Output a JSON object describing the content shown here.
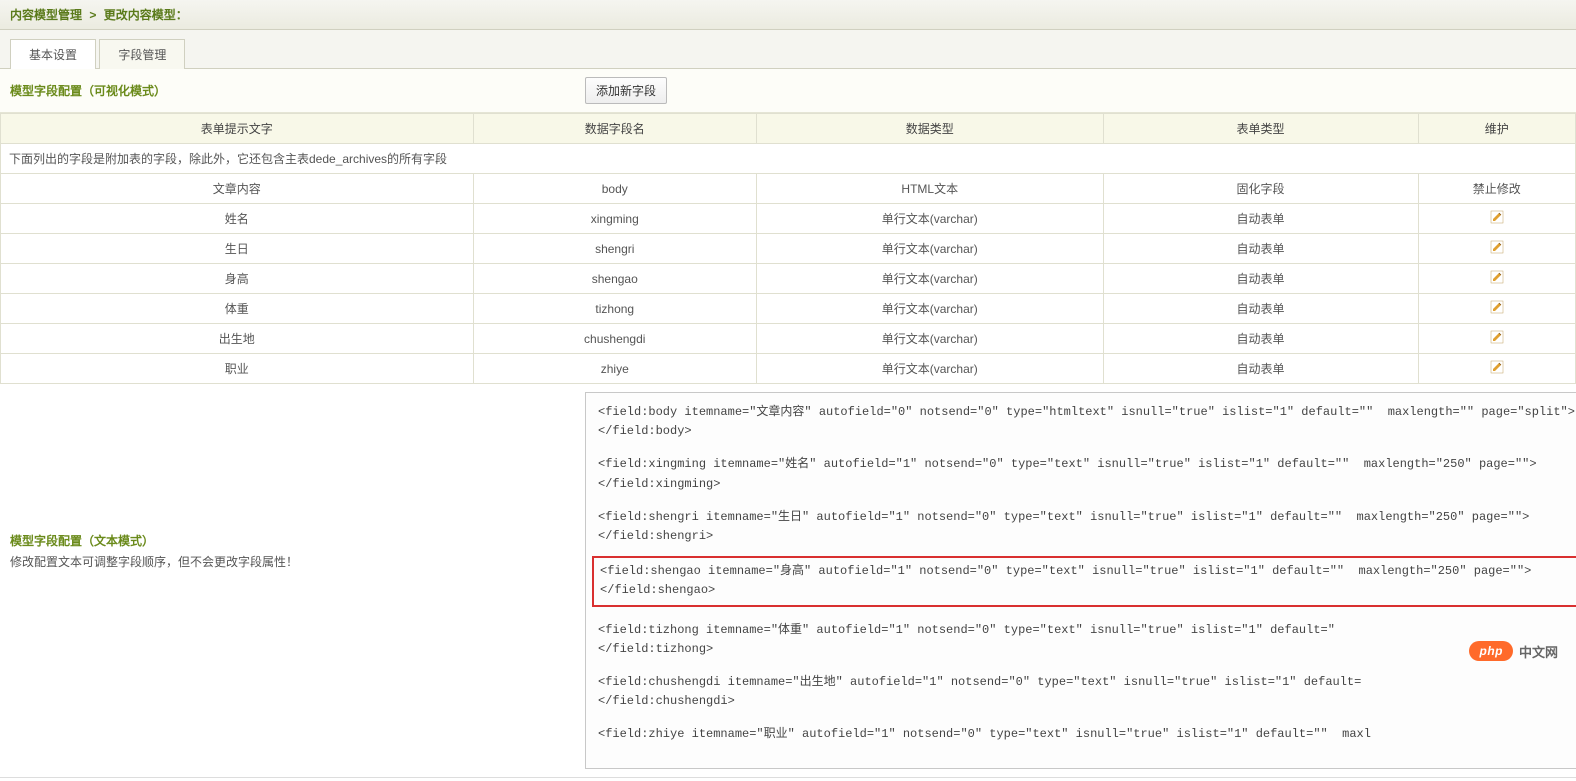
{
  "breadcrumb": {
    "root": "内容模型管理",
    "separator": ">",
    "current": "更改内容模型："
  },
  "tabs": {
    "basic": "基本设置",
    "fields": "字段管理"
  },
  "section": {
    "visual_title": "模型字段配置（可视化模式）",
    "add_button": "添加新字段"
  },
  "table": {
    "headers": {
      "prompt": "表单提示文字",
      "field_name": "数据字段名",
      "data_type": "数据类型",
      "form_type": "表单类型",
      "maintain": "维护"
    },
    "note": "下面列出的字段是附加表的字段，除此外，它还包含主表dede_archives的所有字段",
    "rows": [
      {
        "prompt": "文章内容",
        "name": "body",
        "dtype": "HTML文本",
        "ftype": "固化字段",
        "maintain": "禁止修改",
        "editable": false
      },
      {
        "prompt": "姓名",
        "name": "xingming",
        "dtype": "单行文本(varchar)",
        "ftype": "自动表单",
        "maintain": "",
        "editable": true
      },
      {
        "prompt": "生日",
        "name": "shengri",
        "dtype": "单行文本(varchar)",
        "ftype": "自动表单",
        "maintain": "",
        "editable": true
      },
      {
        "prompt": "身高",
        "name": "shengao",
        "dtype": "单行文本(varchar)",
        "ftype": "自动表单",
        "maintain": "",
        "editable": true
      },
      {
        "prompt": "体重",
        "name": "tizhong",
        "dtype": "单行文本(varchar)",
        "ftype": "自动表单",
        "maintain": "",
        "editable": true
      },
      {
        "prompt": "出生地",
        "name": "chushengdi",
        "dtype": "单行文本(varchar)",
        "ftype": "自动表单",
        "maintain": "",
        "editable": true
      },
      {
        "prompt": "职业",
        "name": "zhiye",
        "dtype": "单行文本(varchar)",
        "ftype": "自动表单",
        "maintain": "",
        "editable": true
      }
    ]
  },
  "text_mode": {
    "heading": "模型字段配置（文本模式）",
    "hint": "修改配置文本可调整字段顺序，但不会更改字段属性！",
    "blocks": [
      {
        "open": "<field:body itemname=\"文章内容\" autofield=\"0\" notsend=\"0\" type=\"htmltext\" isnull=\"true\" islist=\"1\" default=\"\"  maxlength=\"\" page=\"split\">",
        "close": "</field:body>",
        "highlight": false
      },
      {
        "open": "<field:xingming itemname=\"姓名\" autofield=\"1\" notsend=\"0\" type=\"text\" isnull=\"true\" islist=\"1\" default=\"\"  maxlength=\"250\" page=\"\">",
        "close": "</field:xingming>",
        "highlight": false
      },
      {
        "open": "<field:shengri itemname=\"生日\" autofield=\"1\" notsend=\"0\" type=\"text\" isnull=\"true\" islist=\"1\" default=\"\"  maxlength=\"250\" page=\"\">",
        "close": "</field:shengri>",
        "highlight": false
      },
      {
        "open": "<field:shengao itemname=\"身高\" autofield=\"1\" notsend=\"0\" type=\"text\" isnull=\"true\" islist=\"1\" default=\"\"  maxlength=\"250\" page=\"\">",
        "close": "</field:shengao>",
        "highlight": true
      },
      {
        "open": "<field:tizhong itemname=\"体重\" autofield=\"1\" notsend=\"0\" type=\"text\" isnull=\"true\" islist=\"1\" default=\"",
        "close": "</field:tizhong>",
        "highlight": false
      },
      {
        "open": "<field:chushengdi itemname=\"出生地\" autofield=\"1\" notsend=\"0\" type=\"text\" isnull=\"true\" islist=\"1\" default=",
        "close": "</field:chushengdi>",
        "highlight": false
      },
      {
        "open": "<field:zhiye itemname=\"职业\" autofield=\"1\" notsend=\"0\" type=\"text\" isnull=\"true\" islist=\"1\" default=\"\"  maxl",
        "close": "",
        "highlight": false
      }
    ]
  },
  "watermark": {
    "pill": "php",
    "site": "中文网"
  }
}
